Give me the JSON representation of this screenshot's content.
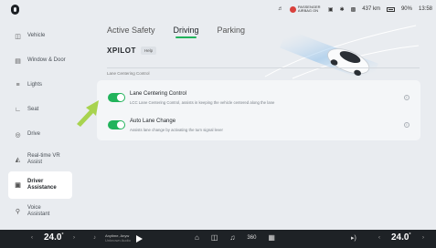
{
  "status": {
    "airbag_text": "PASSENGER AIRBAG ON",
    "distance": "437 km",
    "battery": "90%",
    "time": "13:58"
  },
  "sidebar": {
    "items": [
      {
        "label": "Vehicle",
        "icon": "car-icon"
      },
      {
        "label": "Window & Door",
        "icon": "window-icon"
      },
      {
        "label": "Lights",
        "icon": "light-icon"
      },
      {
        "label": "Seat",
        "icon": "seat-icon"
      },
      {
        "label": "Drive",
        "icon": "steering-icon"
      },
      {
        "label": "Real-time VR Assist",
        "icon": "vr-icon"
      },
      {
        "label": "Driver Assistance",
        "icon": "assist-icon",
        "active": true
      },
      {
        "label": "Voice Assistant",
        "icon": "voice-icon"
      }
    ]
  },
  "tabs": [
    "Active Safety",
    "Driving",
    "Parking"
  ],
  "active_tab": "Driving",
  "header": {
    "title": "XPILOT",
    "help": "Help"
  },
  "section": {
    "title": "Lane Centering Control"
  },
  "settings": [
    {
      "title": "Lane Centering Control",
      "desc": "LCC Lane Centering Control, assists in keeping the vehicle centered along the lane",
      "enabled": true
    },
    {
      "title": "Auto Lane Change",
      "desc": "Assists lane change by activating the turn signal lever",
      "enabled": true
    }
  ],
  "bottom": {
    "temp_left": "24.0",
    "temp_right": "24.0",
    "temp_unit": "°",
    "media_line1": "Anytime, Anyw",
    "media_line2": "Unknown Audio"
  },
  "colors": {
    "accent": "#21b35b",
    "arrow": "#a8d34f"
  }
}
